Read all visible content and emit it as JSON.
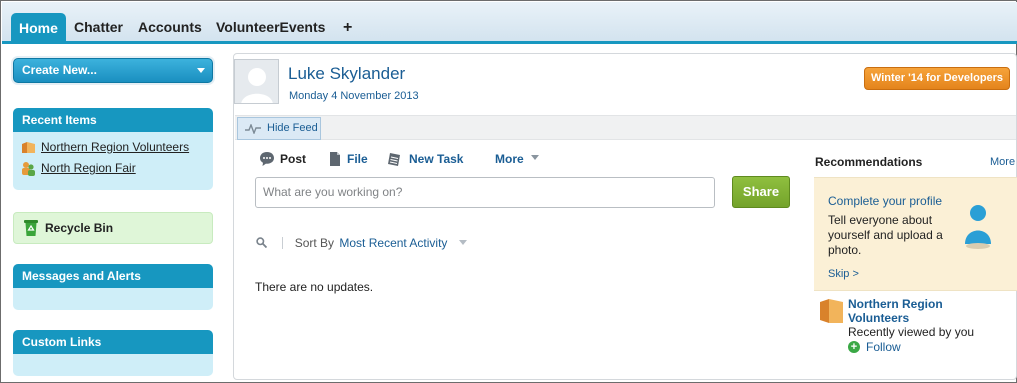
{
  "tabs": [
    {
      "label": "Home",
      "active": true
    },
    {
      "label": "Chatter",
      "active": false
    },
    {
      "label": "Accounts",
      "active": false
    },
    {
      "label": "VolunteerEvents",
      "active": false
    },
    {
      "label": "+",
      "active": false
    }
  ],
  "sidebar": {
    "create_new_label": "Create New...",
    "recent_items": {
      "title": "Recent Items",
      "items": [
        {
          "label": "Northern Region Volunteers",
          "icon": "folder-icon"
        },
        {
          "label": "North Region Fair",
          "icon": "group-icon"
        }
      ]
    },
    "recycle_bin_label": "Recycle Bin",
    "messages_title": "Messages and Alerts",
    "custom_links_title": "Custom Links"
  },
  "profile": {
    "name": "Luke Skylander",
    "date": "Monday 4 November 2013"
  },
  "promo_button": "Winter '14 for Developers",
  "feed": {
    "hide_feed_label": "Hide Feed",
    "publisher_tabs": [
      "Post",
      "File",
      "New Task",
      "More"
    ],
    "composer_placeholder": "What are you working on?",
    "share_label": "Share",
    "sort_by_label": "Sort By",
    "sort_value": "Most Recent Activity",
    "empty_message": "There are no updates."
  },
  "recommendations": {
    "title": "Recommendations",
    "more_label": "More",
    "profile_card": {
      "title": "Complete your profile",
      "description": "Tell everyone about yourself and upload a photo.",
      "skip_label": "Skip >"
    },
    "item": {
      "name": "Northern Region Volunteers",
      "subtitle": "Recently viewed by you",
      "follow_label": "Follow"
    }
  },
  "colors": {
    "accent": "#1797c0",
    "link": "#1a5d94",
    "share_green": "#7dae32",
    "promo_orange": "#ec8d23"
  }
}
